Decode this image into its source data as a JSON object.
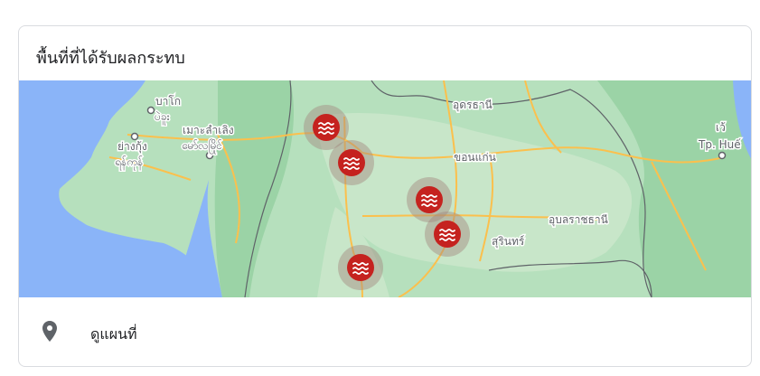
{
  "card": {
    "title": "พื้นที่ที่ได้รับผลกระทบ"
  },
  "map": {
    "labels": [
      {
        "text": "บาโก"
      },
      {
        "text": "ပဲခူး"
      },
      {
        "text": "เมาะลำเลิง"
      },
      {
        "text": "မော်လမြိုင်"
      },
      {
        "text": "ย่างกุ้ง"
      },
      {
        "text": "ရန်ကုန်"
      },
      {
        "text": "อุดรธานี"
      },
      {
        "text": "ขอนแก่น"
      },
      {
        "text": "อุบลราชธานี"
      },
      {
        "text": "สุรินทร์"
      },
      {
        "text": "เว้"
      },
      {
        "text": "Tp. Huế"
      }
    ],
    "markers": [
      {
        "icon": "flood-icon"
      },
      {
        "icon": "flood-icon"
      },
      {
        "icon": "flood-icon"
      },
      {
        "icon": "flood-icon"
      },
      {
        "icon": "flood-icon"
      }
    ],
    "colors": {
      "water": "#8ab4f8",
      "land_green": "#a8dab5",
      "land_light": "#c8e6c9",
      "road": "#fbc04d",
      "marker": "#c5221f"
    }
  },
  "footer": {
    "link_label": "ดูแผนที่",
    "icon": "map-pin-icon"
  }
}
